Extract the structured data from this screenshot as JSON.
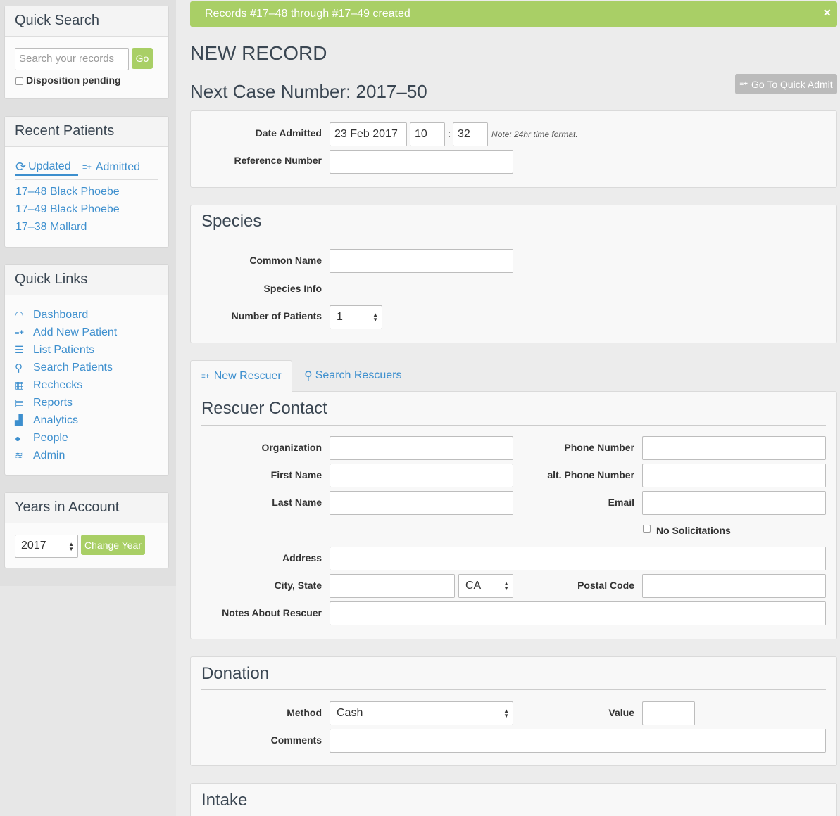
{
  "sidebar": {
    "quick_search": {
      "title": "Quick Search",
      "placeholder": "Search your records",
      "go_label": "Go",
      "disposition_label": "Disposition pending"
    },
    "recent_patients": {
      "title": "Recent Patients",
      "tab_updated": "Updated",
      "tab_admitted": "Admitted",
      "items": [
        "17–48 Black Phoebe",
        "17–49 Black Phoebe",
        "17–38 Mallard"
      ]
    },
    "quick_links": {
      "title": "Quick Links",
      "items": [
        {
          "label": "Dashboard",
          "icon": "dashboard-icon"
        },
        {
          "label": "Add New Patient",
          "icon": "add-list-icon"
        },
        {
          "label": "List Patients",
          "icon": "list-icon"
        },
        {
          "label": "Search Patients",
          "icon": "search-icon"
        },
        {
          "label": "Rechecks",
          "icon": "calendar-icon"
        },
        {
          "label": "Reports",
          "icon": "report-icon"
        },
        {
          "label": "Analytics",
          "icon": "bar-chart-icon"
        },
        {
          "label": "People",
          "icon": "people-icon"
        },
        {
          "label": "Admin",
          "icon": "database-icon"
        }
      ]
    },
    "years": {
      "title": "Years in Account",
      "selected": "2017",
      "change_label": "Change Year"
    }
  },
  "alert": {
    "text": "Records #17–48 through #17–49 created",
    "close": "×"
  },
  "page": {
    "title": "NEW RECORD",
    "case_number": "Next Case Number: 2017–50",
    "quick_admit_label": "Go To Quick Admit"
  },
  "admission": {
    "date_label": "Date Admitted",
    "date_value": "23 Feb 2017",
    "hour": "10",
    "minute": "32",
    "separator": ":",
    "note": "Note: 24hr time format.",
    "reference_label": "Reference Number"
  },
  "species": {
    "title": "Species",
    "common_name_label": "Common Name",
    "info_label": "Species Info",
    "patients_label": "Number of Patients",
    "patients_value": "1"
  },
  "rescuer_tabs": {
    "new": "New Rescuer",
    "search": "Search Rescuers"
  },
  "rescuer": {
    "title": "Rescuer Contact",
    "organization": "Organization",
    "first_name": "First Name",
    "last_name": "Last Name",
    "phone": "Phone Number",
    "alt_phone": "alt. Phone Number",
    "email": "Email",
    "no_solicitations": "No Solicitations",
    "address": "Address",
    "city_state": "City, State",
    "state_value": "CA",
    "postal": "Postal Code",
    "notes": "Notes About Rescuer"
  },
  "donation": {
    "title": "Donation",
    "method_label": "Method",
    "method_value": "Cash",
    "value_label": "Value",
    "comments_label": "Comments"
  },
  "intake": {
    "title": "Intake"
  },
  "colors": {
    "accent": "#3d8fce",
    "success": "#a9cf66",
    "grey_button": "#bbbbbb"
  }
}
